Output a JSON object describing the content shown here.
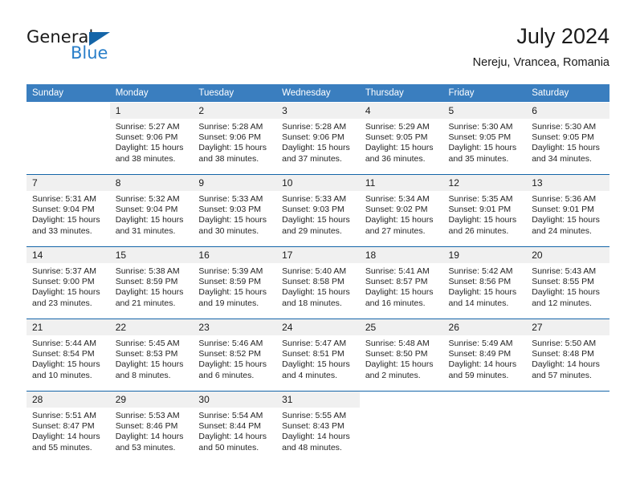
{
  "brand": {
    "name_top": "General",
    "name_bottom": "Blue",
    "triangle_color": "#1565a8",
    "blue_color": "#2a7fc9"
  },
  "header": {
    "month_title": "July 2024",
    "location": "Nereju, Vrancea, Romania"
  },
  "theme": {
    "header_row_bg": "#3a7ebf",
    "day_number_bg": "#f0f0f0",
    "row_separator": "#1565a8"
  },
  "calendar": {
    "weekday_headers": [
      "Sunday",
      "Monday",
      "Tuesday",
      "Wednesday",
      "Thursday",
      "Friday",
      "Saturday"
    ],
    "weeks": [
      [
        {
          "day": "",
          "lines": []
        },
        {
          "day": "1",
          "lines": [
            "Sunrise: 5:27 AM",
            "Sunset: 9:06 PM",
            "Daylight: 15 hours",
            "and 38 minutes."
          ]
        },
        {
          "day": "2",
          "lines": [
            "Sunrise: 5:28 AM",
            "Sunset: 9:06 PM",
            "Daylight: 15 hours",
            "and 38 minutes."
          ]
        },
        {
          "day": "3",
          "lines": [
            "Sunrise: 5:28 AM",
            "Sunset: 9:06 PM",
            "Daylight: 15 hours",
            "and 37 minutes."
          ]
        },
        {
          "day": "4",
          "lines": [
            "Sunrise: 5:29 AM",
            "Sunset: 9:05 PM",
            "Daylight: 15 hours",
            "and 36 minutes."
          ]
        },
        {
          "day": "5",
          "lines": [
            "Sunrise: 5:30 AM",
            "Sunset: 9:05 PM",
            "Daylight: 15 hours",
            "and 35 minutes."
          ]
        },
        {
          "day": "6",
          "lines": [
            "Sunrise: 5:30 AM",
            "Sunset: 9:05 PM",
            "Daylight: 15 hours",
            "and 34 minutes."
          ]
        }
      ],
      [
        {
          "day": "7",
          "lines": [
            "Sunrise: 5:31 AM",
            "Sunset: 9:04 PM",
            "Daylight: 15 hours",
            "and 33 minutes."
          ]
        },
        {
          "day": "8",
          "lines": [
            "Sunrise: 5:32 AM",
            "Sunset: 9:04 PM",
            "Daylight: 15 hours",
            "and 31 minutes."
          ]
        },
        {
          "day": "9",
          "lines": [
            "Sunrise: 5:33 AM",
            "Sunset: 9:03 PM",
            "Daylight: 15 hours",
            "and 30 minutes."
          ]
        },
        {
          "day": "10",
          "lines": [
            "Sunrise: 5:33 AM",
            "Sunset: 9:03 PM",
            "Daylight: 15 hours",
            "and 29 minutes."
          ]
        },
        {
          "day": "11",
          "lines": [
            "Sunrise: 5:34 AM",
            "Sunset: 9:02 PM",
            "Daylight: 15 hours",
            "and 27 minutes."
          ]
        },
        {
          "day": "12",
          "lines": [
            "Sunrise: 5:35 AM",
            "Sunset: 9:01 PM",
            "Daylight: 15 hours",
            "and 26 minutes."
          ]
        },
        {
          "day": "13",
          "lines": [
            "Sunrise: 5:36 AM",
            "Sunset: 9:01 PM",
            "Daylight: 15 hours",
            "and 24 minutes."
          ]
        }
      ],
      [
        {
          "day": "14",
          "lines": [
            "Sunrise: 5:37 AM",
            "Sunset: 9:00 PM",
            "Daylight: 15 hours",
            "and 23 minutes."
          ]
        },
        {
          "day": "15",
          "lines": [
            "Sunrise: 5:38 AM",
            "Sunset: 8:59 PM",
            "Daylight: 15 hours",
            "and 21 minutes."
          ]
        },
        {
          "day": "16",
          "lines": [
            "Sunrise: 5:39 AM",
            "Sunset: 8:59 PM",
            "Daylight: 15 hours",
            "and 19 minutes."
          ]
        },
        {
          "day": "17",
          "lines": [
            "Sunrise: 5:40 AM",
            "Sunset: 8:58 PM",
            "Daylight: 15 hours",
            "and 18 minutes."
          ]
        },
        {
          "day": "18",
          "lines": [
            "Sunrise: 5:41 AM",
            "Sunset: 8:57 PM",
            "Daylight: 15 hours",
            "and 16 minutes."
          ]
        },
        {
          "day": "19",
          "lines": [
            "Sunrise: 5:42 AM",
            "Sunset: 8:56 PM",
            "Daylight: 15 hours",
            "and 14 minutes."
          ]
        },
        {
          "day": "20",
          "lines": [
            "Sunrise: 5:43 AM",
            "Sunset: 8:55 PM",
            "Daylight: 15 hours",
            "and 12 minutes."
          ]
        }
      ],
      [
        {
          "day": "21",
          "lines": [
            "Sunrise: 5:44 AM",
            "Sunset: 8:54 PM",
            "Daylight: 15 hours",
            "and 10 minutes."
          ]
        },
        {
          "day": "22",
          "lines": [
            "Sunrise: 5:45 AM",
            "Sunset: 8:53 PM",
            "Daylight: 15 hours",
            "and 8 minutes."
          ]
        },
        {
          "day": "23",
          "lines": [
            "Sunrise: 5:46 AM",
            "Sunset: 8:52 PM",
            "Daylight: 15 hours",
            "and 6 minutes."
          ]
        },
        {
          "day": "24",
          "lines": [
            "Sunrise: 5:47 AM",
            "Sunset: 8:51 PM",
            "Daylight: 15 hours",
            "and 4 minutes."
          ]
        },
        {
          "day": "25",
          "lines": [
            "Sunrise: 5:48 AM",
            "Sunset: 8:50 PM",
            "Daylight: 15 hours",
            "and 2 minutes."
          ]
        },
        {
          "day": "26",
          "lines": [
            "Sunrise: 5:49 AM",
            "Sunset: 8:49 PM",
            "Daylight: 14 hours",
            "and 59 minutes."
          ]
        },
        {
          "day": "27",
          "lines": [
            "Sunrise: 5:50 AM",
            "Sunset: 8:48 PM",
            "Daylight: 14 hours",
            "and 57 minutes."
          ]
        }
      ],
      [
        {
          "day": "28",
          "lines": [
            "Sunrise: 5:51 AM",
            "Sunset: 8:47 PM",
            "Daylight: 14 hours",
            "and 55 minutes."
          ]
        },
        {
          "day": "29",
          "lines": [
            "Sunrise: 5:53 AM",
            "Sunset: 8:46 PM",
            "Daylight: 14 hours",
            "and 53 minutes."
          ]
        },
        {
          "day": "30",
          "lines": [
            "Sunrise: 5:54 AM",
            "Sunset: 8:44 PM",
            "Daylight: 14 hours",
            "and 50 minutes."
          ]
        },
        {
          "day": "31",
          "lines": [
            "Sunrise: 5:55 AM",
            "Sunset: 8:43 PM",
            "Daylight: 14 hours",
            "and 48 minutes."
          ]
        },
        {
          "day": "",
          "lines": []
        },
        {
          "day": "",
          "lines": []
        },
        {
          "day": "",
          "lines": []
        }
      ]
    ]
  }
}
